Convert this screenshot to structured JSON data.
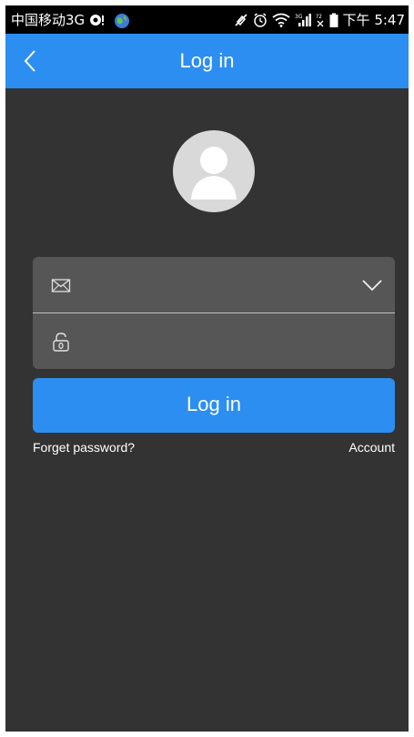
{
  "status_bar": {
    "carrier": "中国移动3G",
    "time": "下午 5:47",
    "icons": [
      "notification-icon",
      "globe-app-icon",
      "mute-icon",
      "alarm-icon",
      "wifi-icon",
      "cellular-3g-signal-icon",
      "sim-no-signal-icon",
      "battery-icon"
    ]
  },
  "header": {
    "title": "Log in",
    "back_icon": "chevron-left-icon"
  },
  "avatar": {
    "icon": "user-silhouette-icon"
  },
  "form": {
    "email": {
      "icon": "envelope-icon",
      "value": "",
      "placeholder": "",
      "dropdown_icon": "chevron-down-icon"
    },
    "password": {
      "icon": "padlock-icon",
      "value": "",
      "placeholder": ""
    }
  },
  "login_button": {
    "label": "Log in"
  },
  "links": {
    "forget_password": "Forget password?",
    "account": "Account"
  },
  "colors": {
    "accent": "#2b8ef0",
    "background": "#333333",
    "panel": "#565656",
    "status_bar": "#000000"
  }
}
